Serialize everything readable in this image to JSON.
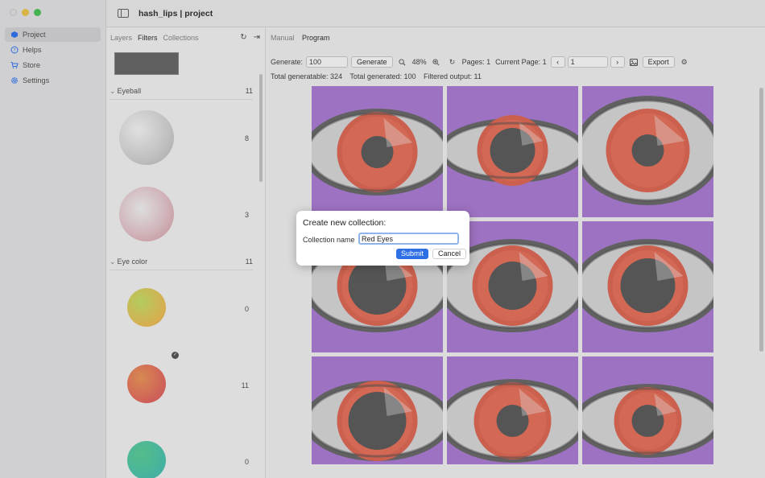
{
  "app": {
    "title": "hash_lips | project"
  },
  "sidebar": {
    "items": [
      {
        "label": "Project",
        "icon": "cube-icon"
      },
      {
        "label": "Helps",
        "icon": "question-icon"
      },
      {
        "label": "Store",
        "icon": "cart-icon"
      },
      {
        "label": "Settings",
        "icon": "gear-icon"
      }
    ]
  },
  "panel": {
    "tabs": [
      "Layers",
      "Filters",
      "Collections"
    ],
    "selected_tab": "Filters",
    "groups": [
      {
        "name": "Eyeball",
        "count": "11",
        "items": [
          {
            "count": "8"
          },
          {
            "count": "3"
          }
        ]
      },
      {
        "name": "Eye color",
        "count": "11",
        "items": [
          {
            "count": "0"
          },
          {
            "count": "11"
          },
          {
            "count": "0"
          }
        ]
      }
    ]
  },
  "main": {
    "modes": [
      "Manual",
      "Program"
    ],
    "selected_mode": "Program",
    "generate_label": "Generate:",
    "generate_value": "100",
    "generate_button": "Generate",
    "zoom": "48%",
    "pages_label": "Pages: 1",
    "current_page_label": "Current Page: 1",
    "page_value": "1",
    "export_button": "Export",
    "stats": {
      "total_generatable": "Total generatable: 324",
      "total_generated": "Total generated: 100",
      "filtered_output": "Filtered output: 11"
    }
  },
  "dialog": {
    "title": "Create new collection:",
    "field_label": "Collection name",
    "field_value": "Red Eyes",
    "submit": "Submit",
    "cancel": "Cancel"
  },
  "colors": {
    "accent": "#2f6fe4",
    "tile_bg": "#b07fd9",
    "iris": "#e36b57",
    "pupil": "#5f5f5f"
  }
}
